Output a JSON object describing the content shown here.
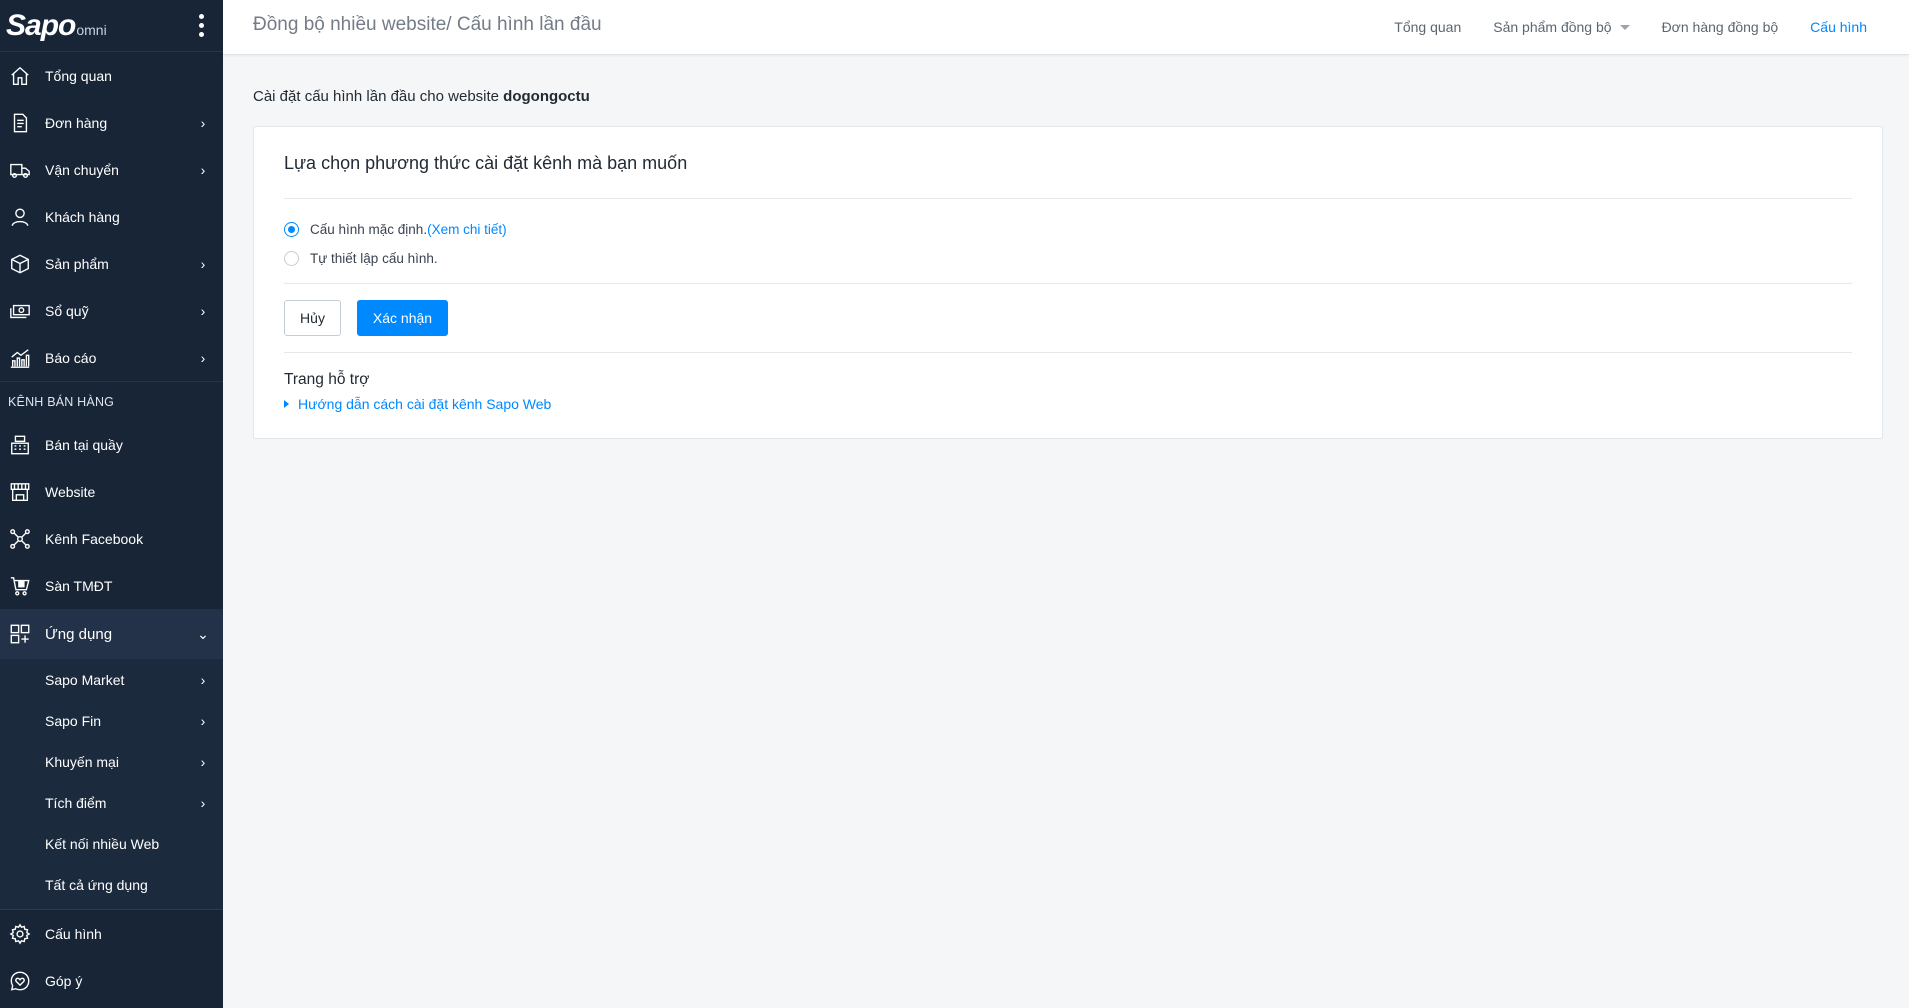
{
  "app": {
    "logo_main": "Sapo",
    "logo_sub": "omni"
  },
  "sidebar": {
    "main_items": [
      {
        "label": "Tổng quan",
        "icon": "home-icon"
      },
      {
        "label": "Đơn hàng",
        "icon": "order-icon",
        "chevron": "›"
      },
      {
        "label": "Vận chuyển",
        "icon": "truck-icon",
        "chevron": "›"
      },
      {
        "label": "Khách hàng",
        "icon": "user-icon"
      },
      {
        "label": "Sản phẩm",
        "icon": "box-icon",
        "chevron": "›"
      },
      {
        "label": "Sổ quỹ",
        "icon": "cash-icon",
        "chevron": "›"
      },
      {
        "label": "Báo cáo",
        "icon": "chart-icon",
        "chevron": "›"
      }
    ],
    "section_header": "KÊNH BÁN HÀNG",
    "channel_items": [
      {
        "label": "Bán tại quầy",
        "icon": "pos-icon"
      },
      {
        "label": "Website",
        "icon": "store-icon"
      },
      {
        "label": "Kênh Facebook",
        "icon": "network-icon"
      },
      {
        "label": "Sàn TMĐT",
        "icon": "ecommerce-icon"
      }
    ],
    "apps_item": {
      "label": "Ứng dụng",
      "icon": "apps-icon",
      "chevron": "⌄"
    },
    "sub_items": [
      {
        "label": "Sapo Market",
        "chevron": "›"
      },
      {
        "label": "Sapo Fin",
        "chevron": "›"
      },
      {
        "label": "Khuyến mại",
        "chevron": "›"
      },
      {
        "label": "Tích điểm",
        "chevron": "›"
      },
      {
        "label": "Kết nối nhiều Web"
      },
      {
        "label": "Tất cả ứng dụng"
      }
    ],
    "bottom_items": [
      {
        "label": "Cấu hình",
        "icon": "gear-icon"
      },
      {
        "label": "Góp ý",
        "icon": "feedback-icon"
      }
    ]
  },
  "header": {
    "title": "Đồng bộ nhiều website/ Cấu hình lần đầu",
    "tabs": [
      {
        "label": "Tổng quan"
      },
      {
        "label": "Sản phẩm đồng bộ"
      },
      {
        "label": "Đơn hàng đồng bộ"
      },
      {
        "label": "Cấu hình"
      }
    ]
  },
  "main": {
    "intro_prefix": "Cài đặt cấu hình lần đầu cho website ",
    "website_name": "dogongoctu",
    "card_title": "Lựa chọn phương thức cài đặt kênh mà bạn muốn",
    "option_default": "Cấu hình mặc định.",
    "option_default_link": "(Xem chi tiết)",
    "option_custom": "Tự thiết lập cấu hình.",
    "selected_option": "default",
    "cancel_label": "Hủy",
    "confirm_label": "Xác nhận",
    "support_title": "Trang hỗ trợ",
    "support_link": "Hướng dẫn cách cài đặt kênh Sapo Web"
  },
  "colors": {
    "sidebar_bg": "#182537",
    "accent": "#0088ff",
    "page_bg": "#f4f6f8"
  }
}
